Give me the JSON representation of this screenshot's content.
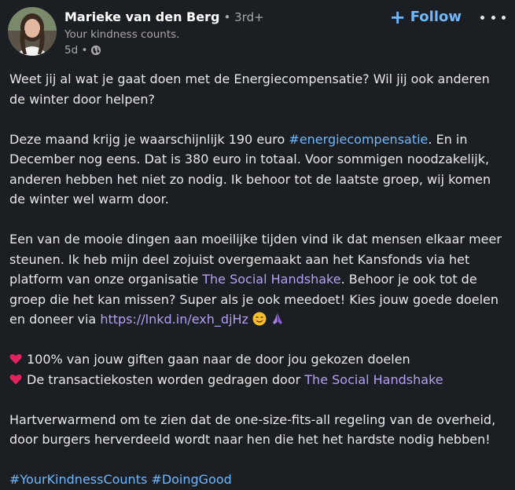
{
  "author": {
    "name": "Marieke van den Berg",
    "degree": "• 3rd+",
    "tagline": "Your kindness counts.",
    "time": "5d •"
  },
  "actions": {
    "follow_label": "Follow",
    "follow_icon": "plus-icon",
    "more_icon": "more-icon"
  },
  "post": {
    "p1": "Weet jij al wat je gaat doen met de Energiecompensatie? Wil jij ook anderen de winter door helpen?",
    "p2_a": "Deze maand krijg je waarschijnlijk 190 euro ",
    "p2_hashtag": "#energiecompensatie",
    "p2_b": ". En in December nog eens. Dat is 380 euro in totaal. Voor sommigen noodzakelijk, anderen hebben het niet zo nodig. Ik behoor tot de laatste groep, wij komen de winter wel warm door.",
    "p3_a": "Een van de mooie dingen aan moeilijke tijden vind ik dat mensen elkaar meer steunen. Ik heb mijn deel zojuist overgemaakt aan het Kansfonds via het platform van onze organisatie ",
    "p3_mention": "The Social Handshake",
    "p3_b": ". Behoor je ook tot de groep die het kan missen? Super als je ook meedoet! Kies jouw goede doelen en doneer via ",
    "p3_link": "https://lnkd.in/exh_djHz",
    "bullet1": "100% van jouw giften gaan naar de door jou gekozen doelen",
    "bullet2_a": "De transactiekosten worden gedragen door ",
    "bullet2_mention": "The Social Handshake",
    "p5": "Hartverwarmend om te zien dat de one-size-fits-all regeling van de overheid, door burgers herverdeeld wordt naar hen die het het hardste nodig hebben!",
    "hashtag1": "#YourKindnessCounts",
    "hashtag2": "#DoingGood"
  },
  "colors": {
    "background": "#1b1f23",
    "text": "#e8e8e8",
    "muted": "#a8a8a8",
    "hashtag": "#71b7fb",
    "mention": "#b59ff5",
    "heart": "#e0245e"
  }
}
